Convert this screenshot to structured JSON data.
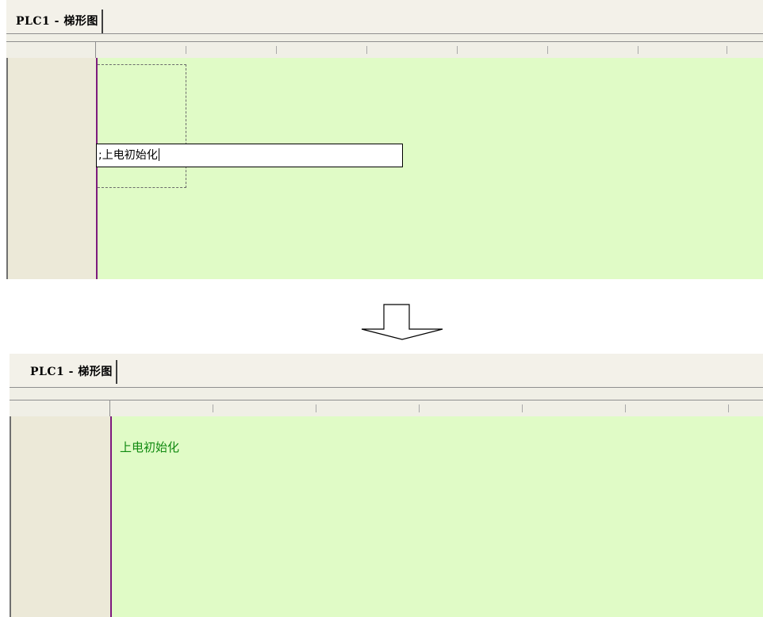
{
  "top_panel": {
    "tab_title": "PLC1 - 梯形图",
    "edit_box_text": ";上电初始化"
  },
  "bottom_panel": {
    "tab_title": "PLC1 - 梯形图",
    "comment_text": "上电初始化"
  },
  "colors": {
    "canvas_bg": "#e0fbc6",
    "power_rail": "#7d1a7d",
    "comment_text": "#108a10"
  }
}
